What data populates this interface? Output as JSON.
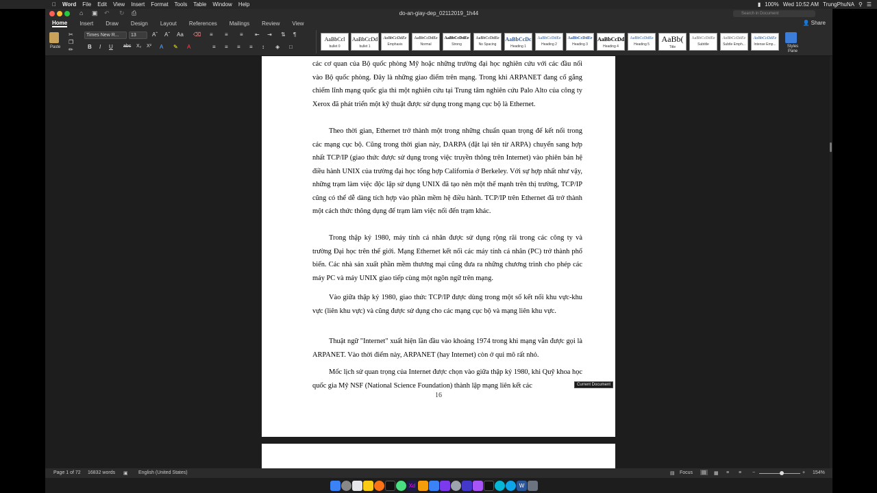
{
  "menubar": {
    "app": "Word",
    "items": [
      "File",
      "Edit",
      "View",
      "Insert",
      "Format",
      "Tools",
      "Table",
      "Window",
      "Help"
    ],
    "battery": "100%",
    "clock": "Wed 10:52 AM",
    "user": "TrungPhuNA"
  },
  "window": {
    "title": "do-an-giay-dep_02112019_1h44",
    "search_placeholder": "Search in Document",
    "share": "Share"
  },
  "tabs": [
    "Home",
    "Insert",
    "Draw",
    "Design",
    "Layout",
    "References",
    "Mailings",
    "Review",
    "View"
  ],
  "ribbon": {
    "paste": "Paste",
    "font": "Times New R...",
    "size": "13",
    "styles_pane": "Styles Pane",
    "styles": [
      {
        "sample": "AaBbCcl",
        "name": "bullet 0"
      },
      {
        "sample": "AaBbCcDd",
        "name": "bullet 1"
      },
      {
        "sample": "AaBbCcDdEe",
        "name": "Emphasis"
      },
      {
        "sample": "AaBbCcDdEe",
        "name": "Normal"
      },
      {
        "sample": "AaBbCcDdEe",
        "name": "Strong"
      },
      {
        "sample": "AaBbCcDdEe",
        "name": "No Spacing"
      },
      {
        "sample": "AaBbCcDc",
        "name": "Heading 1"
      },
      {
        "sample": "AaBbCcDdEe",
        "name": "Heading 2"
      },
      {
        "sample": "AaBbCcDdEe",
        "name": "Heading 3"
      },
      {
        "sample": "AaBbCcDdi",
        "name": "Heading 4"
      },
      {
        "sample": "AaBbCcDdEe",
        "name": "Heading 5"
      },
      {
        "sample": "AaBb(",
        "name": "Title"
      },
      {
        "sample": "AaBbCcDdEe",
        "name": "Subtitle"
      },
      {
        "sample": "AaBbCcDdEe",
        "name": "Subtle Emph..."
      },
      {
        "sample": "AaBbCcDdEe",
        "name": "Intense Emp..."
      }
    ]
  },
  "document": {
    "p0": "các cơ quan của Bộ quốc phòng Mỹ hoặc những trường đại học nghiên cứu với các đầu nối vào Bộ quốc phòng. Đây là những giao điểm trên mạng. Trong khi ARPANET đang cố gắng chiếm lĩnh mạng quốc gia thì một nghiên cứu tại Trung tâm nghiên cứu Palo Alto của công ty Xerox đã phát triển một kỹ thuật được sử dụng trong mạng cục bộ là Ethernet.",
    "p1": "Theo thời gian, Ethernet trở thành một trong những chuẩn quan trọng để kết nối trong các mạng cục bộ. Cũng trong thời gian này, DARPA (đặt lại tên từ ARPA) chuyển sang hợp nhất TCP/IP (giao thức được sử dụng trong việc truyền thông trên Internet) vào phiên bản hệ điều hành UNIX của trường đại học tổng hợp California ở Berkeley. Với sự hợp nhất như vậy, những trạm làm việc độc lập sử dụng UNIX đã tạo nên một thế mạnh trên thị trường, TCP/IP cũng có thể dễ dàng tích hợp vào phần mềm hệ điều hành. TCP/IP trên Ethernet đã trở thành một cách thức thông dụng để trạm làm việc nối đến trạm khác.",
    "p2": "Trong thập kỷ 1980, máy tính cá nhân được sử dụng rộng rãi trong các công ty và trường Đại học trên thế giới. Mạng Ethernet kết nối các máy tính cá nhân (PC) trở thành phổ biến. Các nhà sản xuất phần mềm thương mại cũng đưa ra những chương trình cho phép các máy PC và máy UNIX giao tiếp cùng một ngôn ngữ trên mạng.",
    "p3": "Vào giữa thập kỷ 1980, giao thức TCP/IP được dùng trong một số kết nối khu vực-khu vực (liên khu vực) và cũng được sử dụng cho các mạng cục bộ và mạng liên khu vực.",
    "p4": "Thuật ngữ \"Internet\" xuất hiện lần đầu vào khoảng 1974 trong khi mạng vẫn được gọi là ARPANET. Vào thời điểm này, ARPANET (hay Internet) còn ở qui mô rất nhỏ.",
    "p5": "Mốc lịch sử quan trọng của Internet được chọn vào giữa thập kỷ 1980, khi Quỹ khoa học quốc gia Mỹ NSF (National Science Foundation) thành lập mạng liên kết các",
    "page_number": "16",
    "tooltip": "Current Document"
  },
  "status": {
    "page": "Page 1 of 72",
    "words": "16832 words",
    "language": "English (United States)",
    "focus": "Focus",
    "zoom": "154%"
  },
  "colors": {
    "accent": "#2b579a",
    "chrome": "#2b2b2b",
    "spell": "#d22"
  }
}
